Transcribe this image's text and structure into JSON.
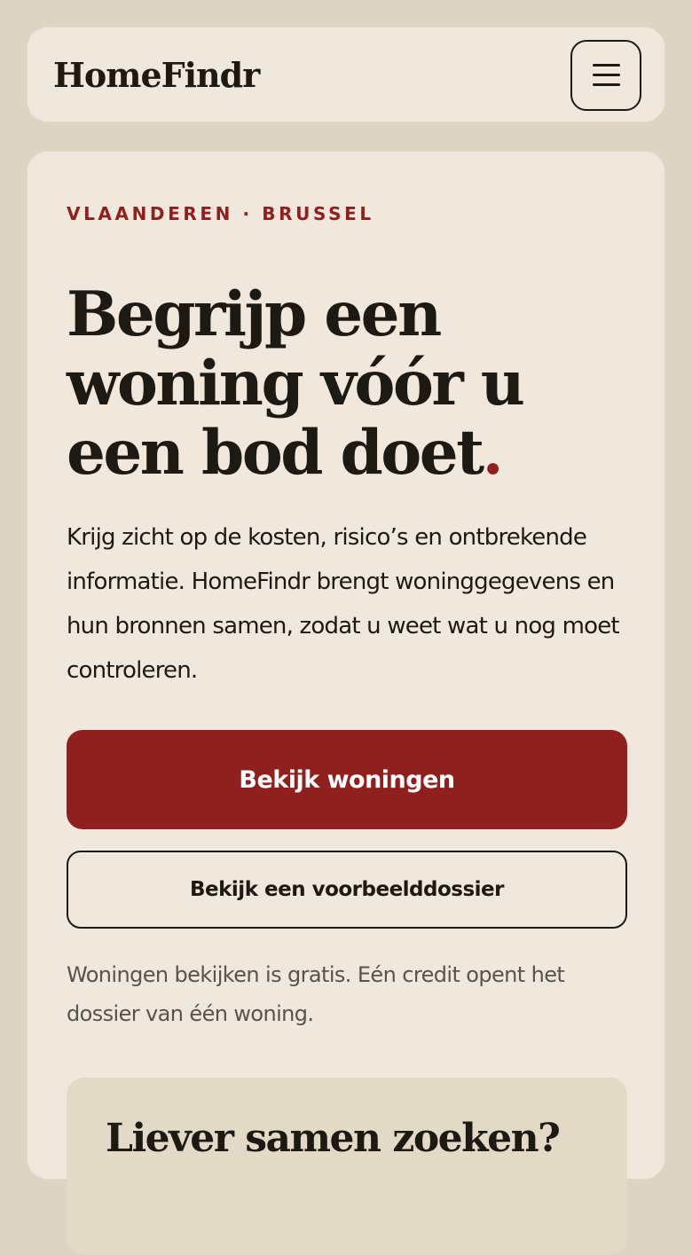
{
  "header": {
    "logo": "HomeFindr",
    "menu_icon": "hamburger-menu-icon"
  },
  "hero": {
    "eyebrow": "VLAANDEREN · BRUSSEL",
    "headline_line1": "Begrijp een",
    "headline_line2": "woning vóór u",
    "headline_line3": "een bod doet",
    "headline_dot": ".",
    "intro": "Krijg zicht op de kosten, risico’s en ontbrekende informatie. HomeFindr brengt woninggegevens en hun bronnen samen, zodat u weet wat u nog moet controleren.",
    "primary_button": "Bekijk woningen",
    "secondary_button": "Bekijk een voorbeelddossier",
    "note": "Woningen bekijken is gratis. Eén credit opent het dossier van één woning."
  },
  "help_card": {
    "title": "Liever samen zoeken?"
  },
  "colors": {
    "background": "#ddd5c3",
    "surface": "#f0e8dc",
    "accent": "#8f201d",
    "text": "#1d1a14",
    "muted_text": "#5a534b",
    "subcard": "#e2d9c6"
  }
}
